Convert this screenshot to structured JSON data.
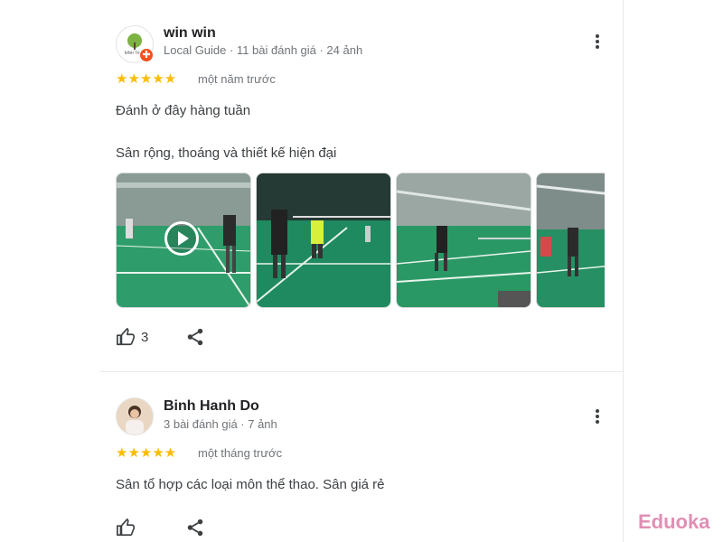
{
  "reviews": [
    {
      "author": "win win",
      "meta": "Local Guide · 11 bài đánh giá · 24 ảnh",
      "stars": "★★★★★",
      "rating": 5,
      "time": "một năm trước",
      "text_1": "Đánh ở đây hàng tuần",
      "text_2": "Sân rộng, thoáng và thiết kế hiện đại",
      "like_count": "3",
      "avatar_logo_text": "NINH THAO"
    },
    {
      "author": "Binh Hanh Do",
      "meta": "3 bài đánh giá · 7 ảnh",
      "stars": "★★★★★",
      "rating": 5,
      "time": "một tháng trước",
      "text_1": "Sân tổ hợp các loại môn thể thao. Sân giá rẻ"
    }
  ],
  "watermark": "Eduoka",
  "colors": {
    "star": "#fbbc04",
    "court": "#1f8a5f",
    "local_guide_badge": "#f4511e",
    "watermark": "#e08fb4"
  }
}
